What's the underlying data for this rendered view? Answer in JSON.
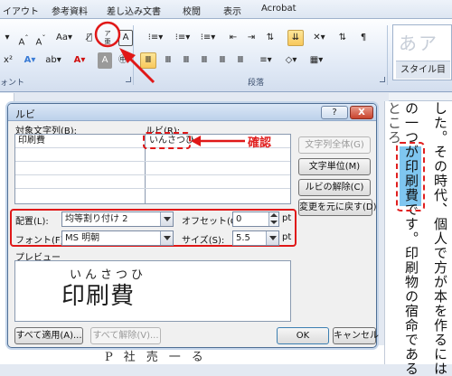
{
  "ribbon": {
    "tabs": [
      "イアウト",
      "参考資料",
      "差し込み文書",
      "校閲",
      "表示",
      "Acrobat"
    ],
    "group_labels": [
      "ォント",
      "段落"
    ],
    "style_preview": "あア亜",
    "style_label": "スタイル目"
  },
  "dialog": {
    "title": "ルビ",
    "help": "?",
    "close": "X",
    "base_header": "対象文字列(B):",
    "ruby_header": "ルビ(R):",
    "rows": [
      {
        "base": "印刷費",
        "ruby": "いんさつひ"
      },
      {
        "base": "",
        "ruby": ""
      },
      {
        "base": "",
        "ruby": ""
      },
      {
        "base": "",
        "ruby": ""
      },
      {
        "base": "",
        "ruby": ""
      }
    ],
    "buttons": {
      "whole": "文字列全体(G)",
      "per_char": "文字単位(M)",
      "remove": "ルビの解除(C)",
      "reset": "変更を元に戻す(D)",
      "apply_all": "すべて適用(A)...",
      "remove_all": "すべて解除(V)...",
      "ok": "OK",
      "cancel": "キャンセル"
    },
    "alignment_label": "配置(L):",
    "alignment_value": "均等割り付け 2",
    "offset_label": "オフセット(O):",
    "offset_value": "0",
    "offset_unit": "pt",
    "font_label": "フォント(F):",
    "font_value": "MS 明朝",
    "size_label": "サイズ(S):",
    "size_value": "5.5",
    "size_unit": "pt",
    "preview_label": "プレビュー",
    "preview_ruby": "いんさつひ",
    "preview_base": "印刷費"
  },
  "annotation": {
    "confirm": "確認",
    "color": "#e02020"
  },
  "document": {
    "col1": "した。その時代、個人で方が本を作るには",
    "col2": "の一つが印刷費です。印刷物の宿命である",
    "col3": "ところ"
  }
}
